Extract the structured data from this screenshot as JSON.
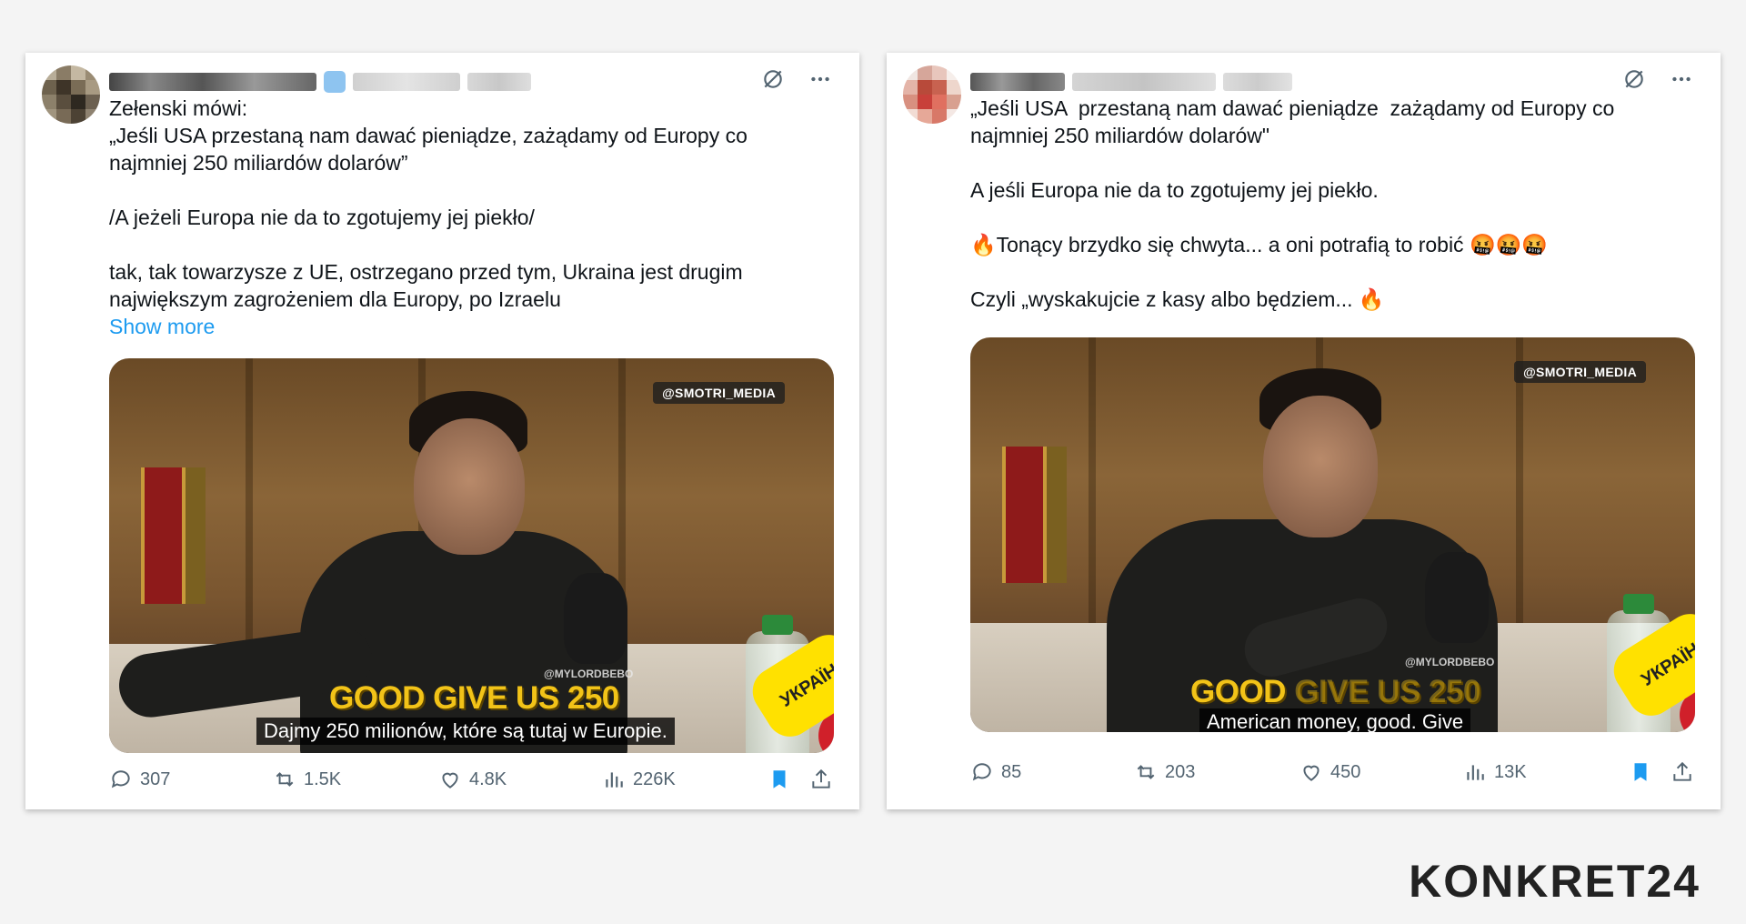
{
  "left_tweet": {
    "text": "Zełenski mówi:\n„Jeśli USA przestaną nam dawać pieniądze, zażądamy od Europy co najmniej 250 miliardów dolarów”\n\n/A jeżeli Europa nie da to zgotujemy jej piekło/\n\ntak, tak towarzysze z UE, ostrzegano przed tym, Ukraina jest drugim największym zagrożeniem dla Europy, po Izraelu",
    "show_more": "Show more",
    "media": {
      "watermark": "@SMOTRI_MEDIA",
      "credit": "@MYLORDBEBO",
      "headline": "GOOD GIVE US 250",
      "subtitle": "Dajmy 250 milionów, które są tutaj w Europie.",
      "mic_text": "УКРАЇН"
    },
    "replies": "307",
    "reposts": "1.5K",
    "likes": "4.8K",
    "views": "226K"
  },
  "right_tweet": {
    "text": "„Jeśli USA  przestaną nam dawać pieniądze  zażądamy od Europy co najmniej 250 miliardów dolarów\"\n\nA jeśli Europa nie da to zgotujemy jej piekło.\n\n🔥Tonący brzydko się chwyta... a oni potrafią to robić 🤬🤬🤬\n\nCzyli „wyskakujcie z kasy albo będziem... 🔥",
    "media": {
      "watermark": "@SMOTRI_MEDIA",
      "credit": "@MYLORDBEBO",
      "headline_main": "GOOD ",
      "headline_ghost": "GIVE US 250",
      "subtitle": "American money, good. Give",
      "mic_text": "УКРАЇН"
    },
    "replies": "85",
    "reposts": "203",
    "likes": "450",
    "views": "13K"
  },
  "brand": {
    "logo": "KONKRET24"
  },
  "colors": {
    "link": "#1d9bf0",
    "bookmark": "#1d9bf0",
    "action_gray": "#536471"
  }
}
